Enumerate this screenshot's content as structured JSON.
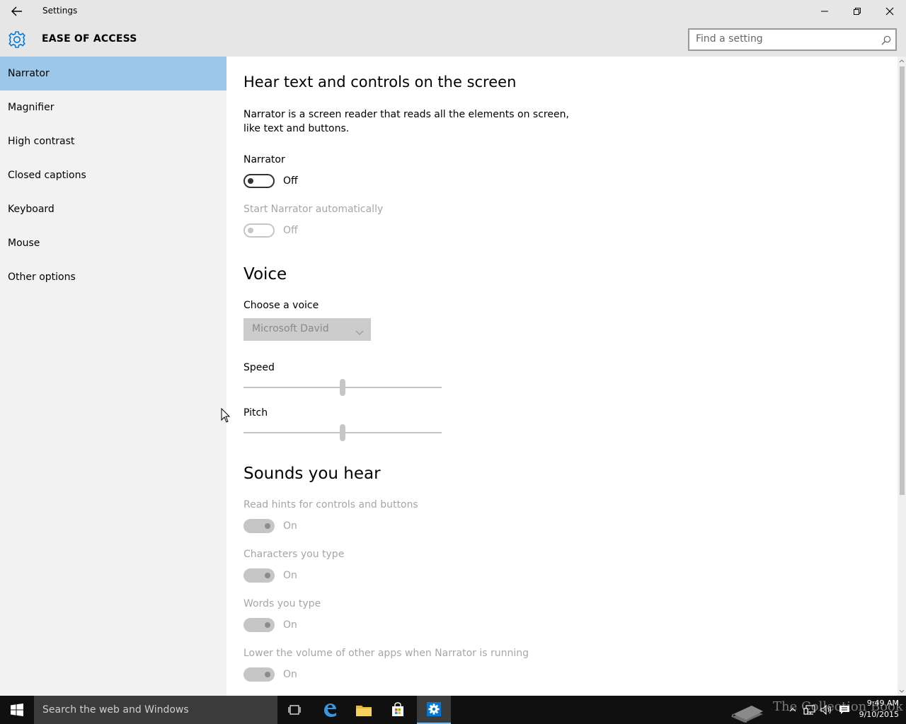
{
  "window": {
    "title": "Settings",
    "back_icon": "back-arrow-icon",
    "minimize_icon": "minimize-icon",
    "restore_icon": "restore-icon",
    "close_icon": "close-icon"
  },
  "header": {
    "icon": "gear-icon",
    "title": "EASE OF ACCESS",
    "search": {
      "placeholder": "Find a setting",
      "value": "",
      "icon": "search-icon"
    }
  },
  "sidebar": {
    "items": [
      {
        "label": "Narrator",
        "active": true
      },
      {
        "label": "Magnifier",
        "active": false
      },
      {
        "label": "High contrast",
        "active": false
      },
      {
        "label": "Closed captions",
        "active": false
      },
      {
        "label": "Keyboard",
        "active": false
      },
      {
        "label": "Mouse",
        "active": false
      },
      {
        "label": "Other options",
        "active": false
      }
    ]
  },
  "main": {
    "heading": "Hear text and controls on the screen",
    "description_line1": "Narrator is a screen reader that reads all the elements on screen,",
    "description_line2": "like text and buttons.",
    "narrator": {
      "label": "Narrator",
      "state": "Off"
    },
    "start_auto": {
      "label": "Start Narrator automatically",
      "state": "Off",
      "disabled": true
    },
    "voice": {
      "heading": "Voice",
      "choose_label": "Choose a voice",
      "selected": "Microsoft David",
      "speed_label": "Speed",
      "speed_level": 0.5,
      "pitch_label": "Pitch",
      "pitch_level": 0.5
    },
    "sounds": {
      "heading": "Sounds you hear",
      "items": [
        {
          "label": "Read hints for controls and buttons",
          "state": "On"
        },
        {
          "label": "Characters you type",
          "state": "On"
        },
        {
          "label": "Words you type",
          "state": "On"
        },
        {
          "label": "Lower the volume of other apps when Narrator is running",
          "state": "On"
        }
      ]
    }
  },
  "taskbar": {
    "search_text": "Search the web and Windows",
    "watermark": "The Collection Book",
    "time": "9:49 AM",
    "date": "9/10/2015",
    "accent": "#76b9ed"
  },
  "colors": {
    "selected_nav": "#9dc7e8",
    "chrome": "#e6e6e6",
    "sidebar": "#f2f2f2",
    "accent_blue": "#0078d7"
  }
}
